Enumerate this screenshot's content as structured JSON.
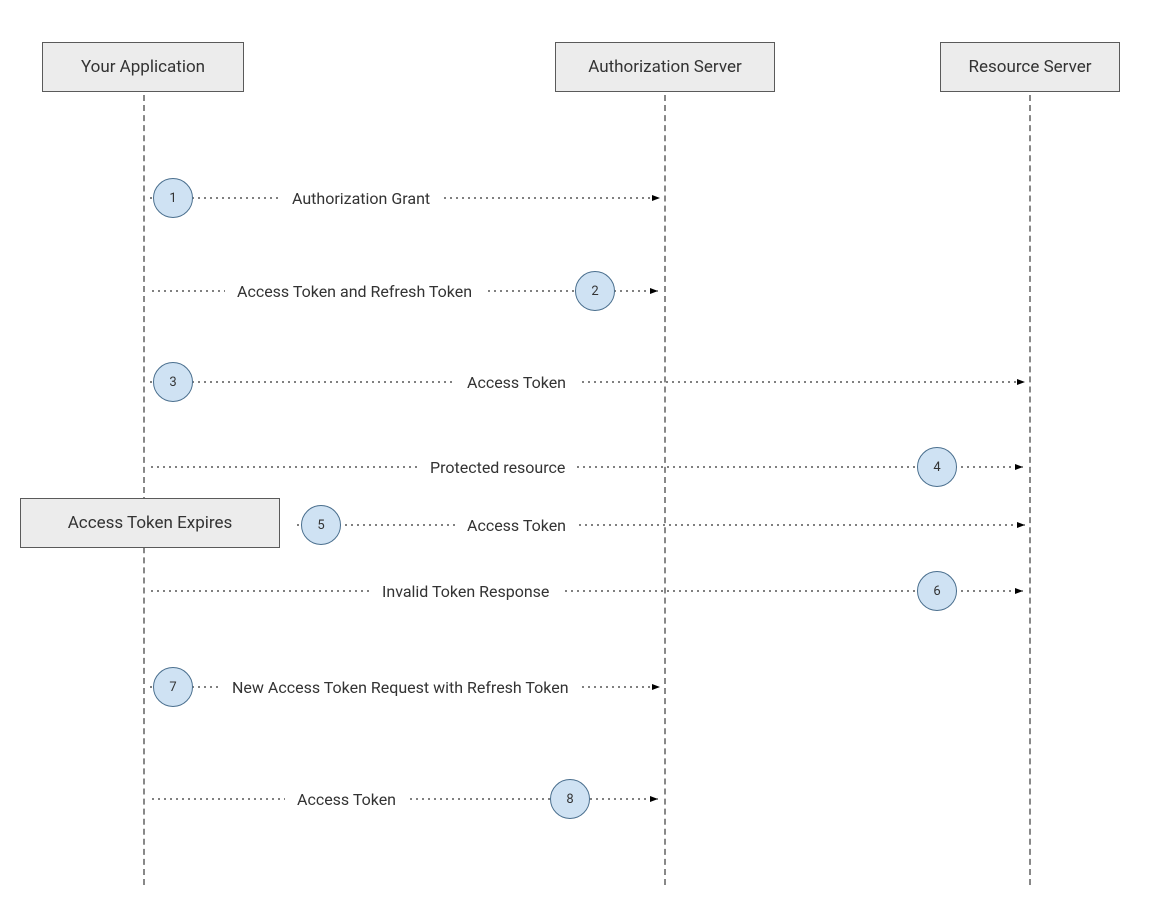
{
  "participants": {
    "app": "Your Application",
    "auth": "Authorization Server",
    "res": "Resource Server"
  },
  "expires_box": "Access Token Expires",
  "messages": {
    "m1": {
      "num": "1",
      "text": "Authorization Grant"
    },
    "m2": {
      "num": "2",
      "text": "Access Token and Refresh Token"
    },
    "m3": {
      "num": "3",
      "text": "Access Token"
    },
    "m4": {
      "num": "4",
      "text": "Protected resource"
    },
    "m5": {
      "num": "5",
      "text": "Access Token"
    },
    "m6": {
      "num": "6",
      "text": "Invalid Token Response"
    },
    "m7": {
      "num": "7",
      "text": "New Access Token Request with Refresh Token"
    },
    "m8": {
      "num": "8",
      "text": "Access Token"
    }
  }
}
